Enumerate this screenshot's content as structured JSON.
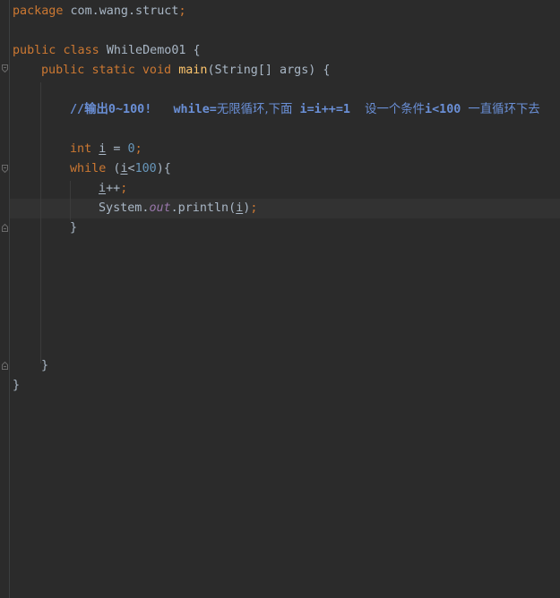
{
  "editor": {
    "lines": {
      "package_kw": "package",
      "package_name": " com.wang.struct",
      "package_semi": ";",
      "class_public": "public",
      "class_kw": "class",
      "class_name": "WhileDemo01",
      "class_brace": " {",
      "main_public": "public",
      "main_static": "static",
      "main_void": "void",
      "main_name": "main",
      "main_params": "(String[] args) {",
      "comment_a": "//输出0~100!",
      "comment_b": "while=",
      "comment_c": "无限循环,下面",
      "comment_d": " i=i++=1",
      "comment_e": "设一个条件",
      "comment_f": "i<100",
      "comment_g": "一直循环下去",
      "int_kw": "int",
      "int_var": "i",
      "int_eq": " = ",
      "int_val": "0",
      "int_semi": ";",
      "while_kw": "while",
      "while_open": " (",
      "while_var": "i",
      "while_lt": "<",
      "while_num": "100",
      "while_close": "){",
      "inc_var": "i",
      "inc_op": "++",
      "inc_semi": ";",
      "print_sys": "System.",
      "print_out": "out",
      "print_call": ".println(",
      "print_var": "i",
      "print_close": ")",
      "print_semi": ";",
      "close_while": "}",
      "close_main": "}",
      "close_class": "}"
    }
  }
}
